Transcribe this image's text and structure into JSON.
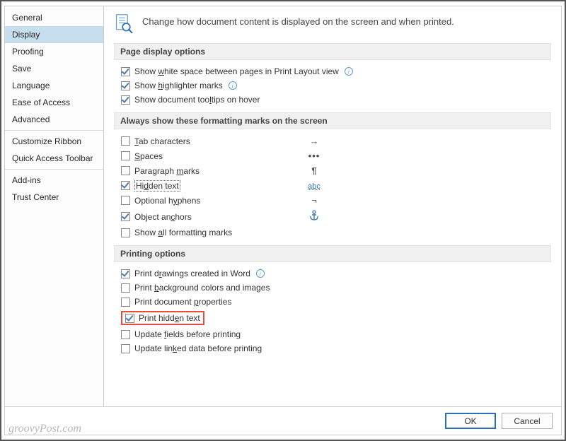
{
  "sidebar": {
    "items": [
      {
        "label": "General"
      },
      {
        "label": "Display"
      },
      {
        "label": "Proofing"
      },
      {
        "label": "Save"
      },
      {
        "label": "Language"
      },
      {
        "label": "Ease of Access"
      },
      {
        "label": "Advanced"
      },
      {
        "label": "Customize Ribbon"
      },
      {
        "label": "Quick Access Toolbar"
      },
      {
        "label": "Add-ins"
      },
      {
        "label": "Trust Center"
      }
    ],
    "selected": "Display"
  },
  "header": {
    "text": "Change how document content is displayed on the screen and when printed."
  },
  "sections": {
    "page_display": {
      "title": "Page display options",
      "opts": {
        "white_space": {
          "pre": "Show ",
          "accel": "w",
          "post": "hite space between pages in Print Layout view",
          "checked": true,
          "info": true
        },
        "highlighter": {
          "pre": "Show ",
          "accel": "h",
          "post": "ighlighter marks",
          "checked": true,
          "info": true
        },
        "tooltips": {
          "pre": "Show document too",
          "accel": "l",
          "post": "tips on hover",
          "checked": true,
          "info": false
        }
      }
    },
    "formatting_marks": {
      "title": "Always show these formatting marks on the screen",
      "opts": {
        "tab": {
          "accel": "T",
          "post": "ab characters",
          "checked": false,
          "glyph": "→"
        },
        "spaces": {
          "accel": "S",
          "post": "paces",
          "checked": false,
          "glyph": "•••"
        },
        "paragraph": {
          "pre": "Paragraph ",
          "accel": "m",
          "post": "arks",
          "checked": false,
          "glyph": "¶"
        },
        "hidden": {
          "pre": "Hi",
          "accel": "d",
          "post": "den text",
          "checked": true,
          "glyph": "abc"
        },
        "hyphens": {
          "pre": "Optional h",
          "accel": "y",
          "post": "phens",
          "checked": false,
          "glyph": "¬"
        },
        "anchors": {
          "pre": "Object an",
          "accel": "c",
          "post": "hors",
          "checked": true,
          "glyph": "anchor"
        },
        "all": {
          "pre": "Show ",
          "accel": "a",
          "post": "ll formatting marks",
          "checked": false
        }
      }
    },
    "printing": {
      "title": "Printing options",
      "opts": {
        "drawings": {
          "pre": "Print d",
          "accel": "r",
          "post": "awings created in Word",
          "checked": true,
          "info": true
        },
        "background": {
          "pre": "Print ",
          "accel": "b",
          "post": "ackground colors and images",
          "checked": false
        },
        "properties": {
          "pre": "Print document ",
          "accel": "p",
          "post": "roperties",
          "checked": false
        },
        "hidden_text": {
          "pre": "Print hidd",
          "accel": "e",
          "post": "n text",
          "checked": true,
          "highlighted": true
        },
        "update_fields": {
          "pre": "Update ",
          "accel": "f",
          "post": "ields before printing",
          "checked": false
        },
        "update_linked": {
          "pre": "Update lin",
          "accel": "k",
          "post": "ed data before printing",
          "checked": false
        }
      }
    }
  },
  "footer": {
    "ok": "OK",
    "cancel": "Cancel"
  },
  "watermark": "groovyPost.com"
}
